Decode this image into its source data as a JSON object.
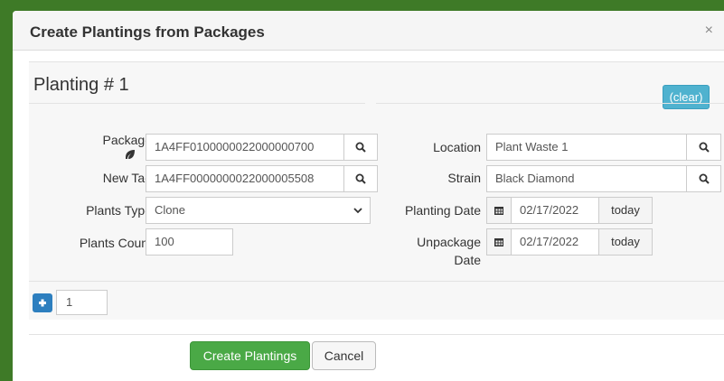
{
  "modal": {
    "title": "Create Plantings from Packages",
    "close_label": "×"
  },
  "planting": {
    "title": "Planting # 1",
    "clear_label": "(clear)"
  },
  "fields": {
    "package": {
      "label": "Package",
      "value": "1A4FF0100000022000000700"
    },
    "new_tag": {
      "label": "New Tag",
      "value": "1A4FF0000000022000005508"
    },
    "plants_type": {
      "label": "Plants Type",
      "value": "Clone"
    },
    "plants_count": {
      "label": "Plants Count",
      "value": "100"
    },
    "location": {
      "label": "Location",
      "value": "Plant Waste 1"
    },
    "strain": {
      "label": "Strain",
      "value": "Black Diamond"
    },
    "planting_date": {
      "label": "Planting Date",
      "value": "02/17/2022",
      "today_label": "today"
    },
    "unpackage_date": {
      "label_line1": "Unpackage",
      "label_line2": "Date",
      "value": "02/17/2022",
      "today_label": "today"
    }
  },
  "add_row": {
    "count": "1"
  },
  "actions": {
    "create_label": "Create Plantings",
    "cancel_label": "Cancel"
  },
  "icons": {
    "search": "search-icon",
    "calendar": "calendar-icon",
    "leaf": "leaf-icon",
    "plus": "plus-icon",
    "chevron": "chevron-down-icon"
  },
  "colors": {
    "background": "#3e7a27",
    "clear_button": "#4fb2cf",
    "create_button": "#4aa946",
    "plus_button": "#2d7fbf"
  }
}
